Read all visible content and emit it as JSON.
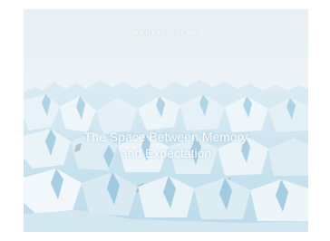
{
  "book_cover": {
    "author": "RENATE ELLER",
    "title_line_1": "The Space Between Memory",
    "title_line_2": "and Expectation"
  }
}
